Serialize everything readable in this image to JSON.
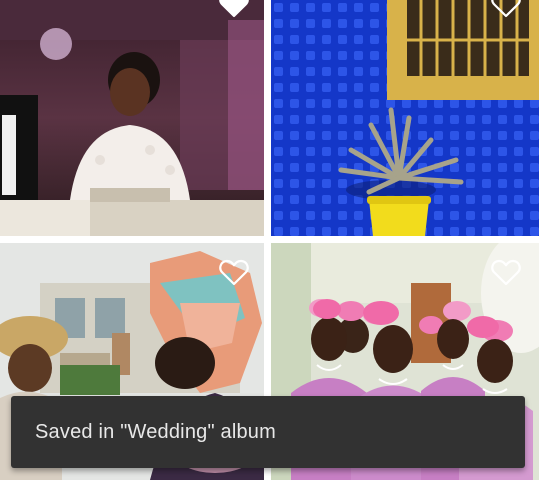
{
  "gallery": {
    "photos": [
      {
        "subject": "bride-at-table",
        "favorite": false
      },
      {
        "subject": "agave-plant-blue-wall",
        "favorite": false
      },
      {
        "subject": "women-in-gele-headwraps",
        "favorite": false
      },
      {
        "subject": "bridesmaids-pink-fascinators",
        "favorite": false
      }
    ],
    "favorite_icon": "heart-outline-icon"
  },
  "snackbar": {
    "message": "Saved in \"Wedding\" album"
  },
  "colors": {
    "snackbar_background": "#323232",
    "snackbar_text": "#e8e8e8",
    "icon": "#ffffff"
  }
}
